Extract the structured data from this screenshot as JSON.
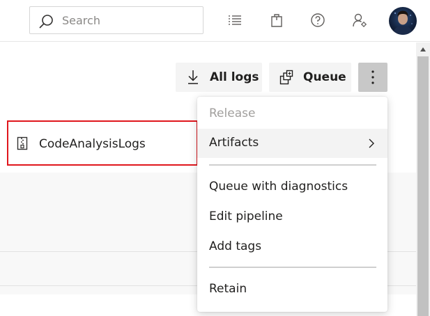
{
  "search": {
    "placeholder": "Search"
  },
  "header_icons": [
    "list-icon",
    "shopping-bag-icon",
    "help-icon",
    "user-settings-icon"
  ],
  "toolbar": {
    "all_logs_label": "All logs",
    "queue_label": "Queue"
  },
  "artifact": {
    "name": "CodeAnalysisLogs",
    "icon": "zip-file-icon"
  },
  "menu": {
    "release": "Release",
    "artifacts": "Artifacts",
    "queue_with_diagnostics": "Queue with diagnostics",
    "edit_pipeline": "Edit pipeline",
    "add_tags": "Add tags",
    "retain": "Retain"
  },
  "colors": {
    "highlight_border": "#e0161c",
    "more_button_active": "#c8c8c8",
    "disabled_text": "#a19f9d"
  }
}
